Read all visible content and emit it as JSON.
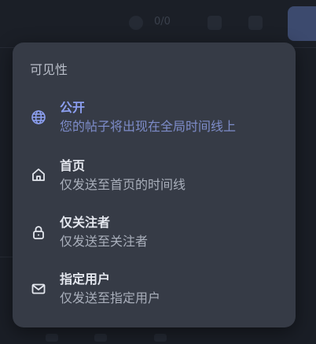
{
  "background": {
    "toolbar_count": "0/0",
    "accent_color": "#3c4a6e"
  },
  "menu": {
    "title": "可见性",
    "options": [
      {
        "label": "公开",
        "description": "您的帖子将出现在全局时间线上",
        "icon": "globe-icon",
        "selected": true
      },
      {
        "label": "首页",
        "description": "仅发送至首页的时间线",
        "icon": "home-icon",
        "selected": false
      },
      {
        "label": "仅关注者",
        "description": "仅发送至关注者",
        "icon": "lock-icon",
        "selected": false
      },
      {
        "label": "指定用户",
        "description": "仅发送至指定用户",
        "icon": "mail-icon",
        "selected": false
      }
    ],
    "colors": {
      "panel": "#363b46",
      "selected_label": "#8c9ff0",
      "selected_description": "#7d8cc9",
      "label": "#e4e7ee",
      "description": "#a9afbb"
    }
  }
}
